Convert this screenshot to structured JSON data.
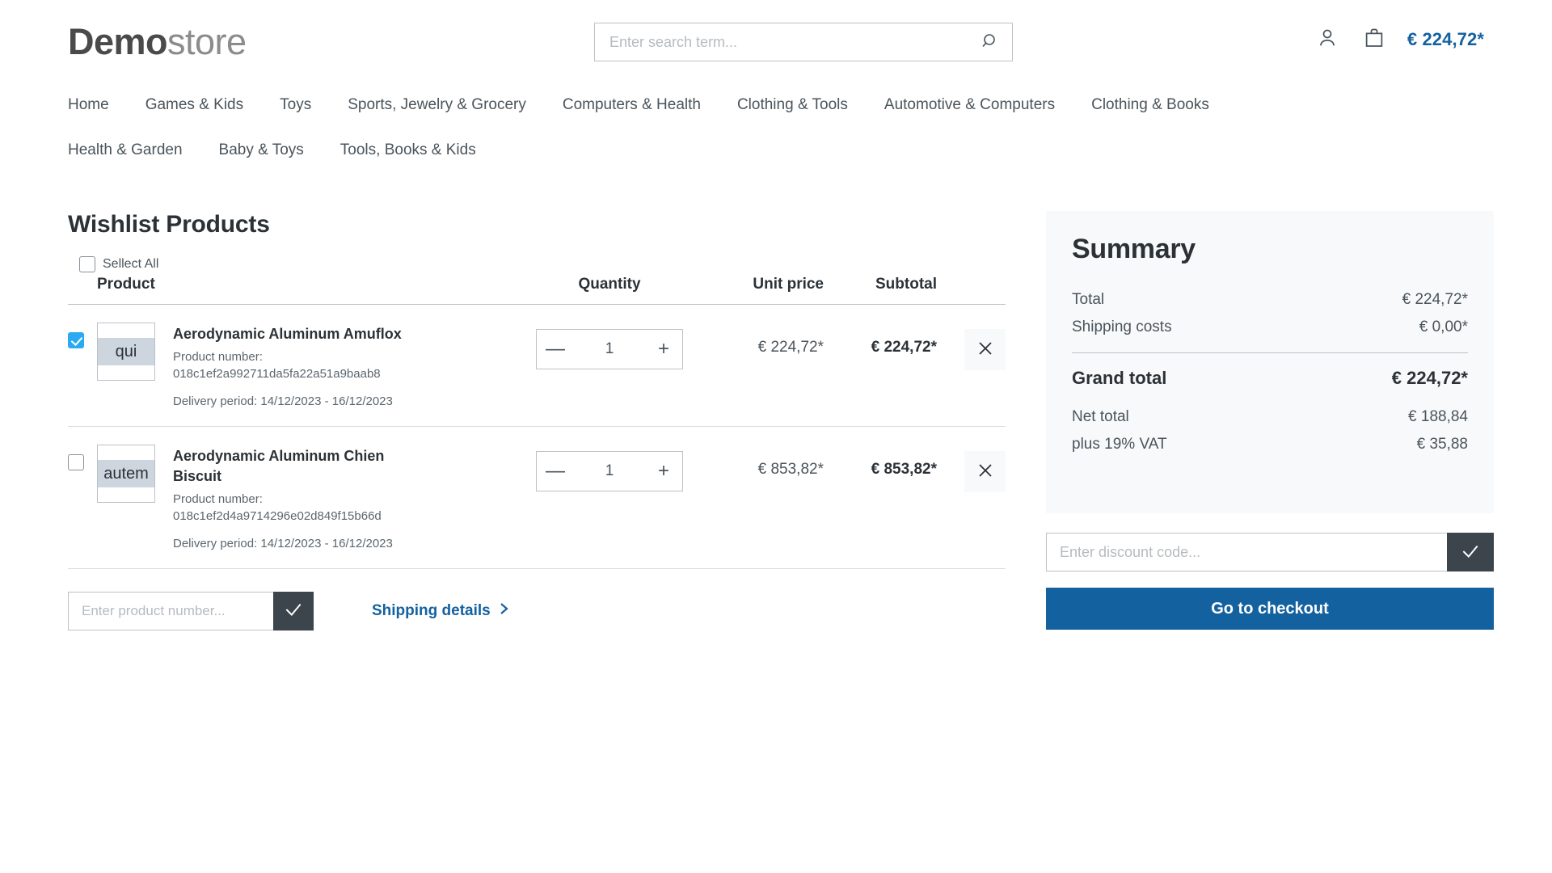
{
  "header": {
    "logo_bold": "Demo",
    "logo_light": "store",
    "search_placeholder": "Enter search term...",
    "search_value": "",
    "search_icon": "search-icon",
    "account_icon": "person-icon",
    "cart_icon": "shopping-bag-icon",
    "cart_total": "€ 224,72*"
  },
  "nav": {
    "items": [
      {
        "label": "Home"
      },
      {
        "label": "Games & Kids"
      },
      {
        "label": "Toys"
      },
      {
        "label": "Sports, Jewelry & Grocery"
      },
      {
        "label": "Computers & Health"
      },
      {
        "label": "Clothing & Tools"
      },
      {
        "label": "Automotive & Computers"
      },
      {
        "label": "Clothing & Books"
      },
      {
        "label": "Health & Garden"
      },
      {
        "label": "Baby & Toys"
      },
      {
        "label": "Tools, Books & Kids"
      }
    ]
  },
  "main": {
    "title": "Wishlist Products",
    "select_all_label": "Sellect All",
    "select_all_checked": false,
    "columns": {
      "product": "Product",
      "quantity": "Quantity",
      "unit_price": "Unit price",
      "subtotal": "Subtotal"
    },
    "rows": [
      {
        "checked": true,
        "thumb_text": "qui",
        "name": "Aerodynamic Aluminum Amuflox",
        "product_number_label": "Product number:",
        "product_number": "018c1ef2a992711da5fa22a51a9baab8",
        "delivery": "Delivery period: 14/12/2023 - 16/12/2023",
        "quantity": "1",
        "minus_label": "—",
        "plus_label": "+",
        "unit_price": "€ 224,72*",
        "subtotal": "€ 224,72*",
        "remove_icon": "close-icon"
      },
      {
        "checked": false,
        "thumb_text": "autem",
        "name": "Aerodynamic Aluminum Chien Biscuit",
        "product_number_label": "Product number:",
        "product_number": "018c1ef2d4a9714296e02d849f15b66d",
        "delivery": "Delivery period: 14/12/2023 - 16/12/2023",
        "quantity": "1",
        "minus_label": "—",
        "plus_label": "+",
        "unit_price": "€ 853,82*",
        "subtotal": "€ 853,82*",
        "remove_icon": "close-icon"
      }
    ],
    "product_number_placeholder": "Enter product number...",
    "product_number_value": "",
    "product_number_submit_icon": "check-icon",
    "shipping_details_label": "Shipping details",
    "shipping_details_icon": "chevron-right-icon"
  },
  "summary": {
    "title": "Summary",
    "lines": [
      {
        "label": "Total",
        "value": "€ 224,72*"
      },
      {
        "label": "Shipping costs",
        "value": "€ 0,00*"
      }
    ],
    "grand_total_label": "Grand total",
    "grand_total_value": "€ 224,72*",
    "sub_lines": [
      {
        "label": "Net total",
        "value": "€ 188,84"
      },
      {
        "label": "plus 19% VAT",
        "value": "€ 35,88"
      }
    ],
    "discount_placeholder": "Enter discount code...",
    "discount_value": "",
    "discount_submit_icon": "check-icon",
    "checkout_label": "Go to checkout"
  },
  "colors": {
    "accent_blue": "#1461a0",
    "checkbox_blue": "#29aaf2",
    "dark_button": "#3c444c",
    "panel_bg": "#f8f9fa",
    "text": "#4a545b"
  }
}
